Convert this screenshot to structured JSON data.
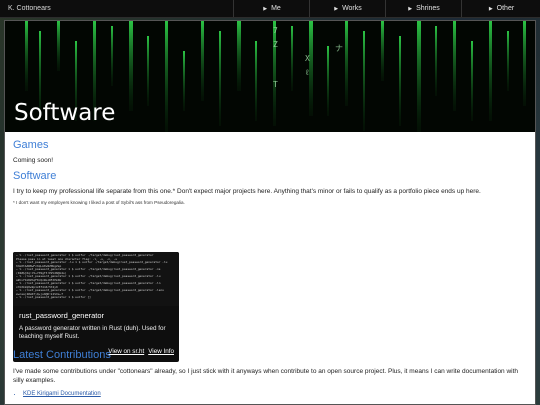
{
  "header": {
    "brand": "K. Cottonears",
    "nav": [
      {
        "label": "Me"
      },
      {
        "label": "Works"
      },
      {
        "label": "Shrines"
      },
      {
        "label": "Other"
      }
    ]
  },
  "hero": {
    "title": "Software"
  },
  "sections": {
    "games": {
      "heading": "Games",
      "text": "Coming soon!"
    },
    "software": {
      "heading": "Software",
      "text": "I try to keep my professional life separate from this one.* Don't expect major projects here. Anything that's minor or fails to qualify as a portfolio piece ends up here.",
      "footnote": "* I don't want my employers knowing I liked a post of Sybil's ass from Pseudoregalia."
    },
    "contributions": {
      "heading": "Latest Contributions",
      "text": "I've made some contributions under \"cottonears\" already, so I just stick with it anyways when contribute to an open source project. Plus, it means I can write documentation with silly examples.",
      "items": [
        "KDE Kirigami Documentation"
      ]
    }
  },
  "project_card": {
    "title": "rust_password_generator",
    "description": "A password generator written in Rust (duh). Used for teaching myself Rust.",
    "link_srht": "View on sr.ht",
    "link_info": "View Info",
    "terminal_lines": [
      "~ % ./rust_password_generator 1 $ sulfur  ./target/debug/rust_password_generator",
      "Please pass in at least one character flag: -l, -u, -n, -s",
      "~ % ./rust_password_generator -lu 1 $ sulfur  ./target/debug/rust_password_generator -lu",
      "h%G0tAdW8wFzXqLm0vWZ0UgZsp",
      "~ % ./rust_password_generator 1 $ sulfur  ./target/debug/rust_password_generator -ns",
      "(02#$]6q:C5+7X9gT3!P2%I8@k4s)",
      "~ % ./rust_password_generator 1 $ sulfur  ./target/debug/rust_password_generator -lu",
      "a#nvY1k8ZhqF0cQxWLzR5tPmbU",
      "~ % ./rust_password_generator 1 $ sulfur  ./target/debug/rust_password_generator -ln",
      "x7m3k2q0w9p1z8f4n6r5t2y0",
      "~ % ./rust_password_generator 1 $ sulfur  ./target/debug/rust_password_generator -lsnu",
      "ewcaa|2#sR7)Q+ju9@D!k1SXa~f",
      "~ % ./rust_password_generator 1 $ sulfur  []"
    ]
  }
}
